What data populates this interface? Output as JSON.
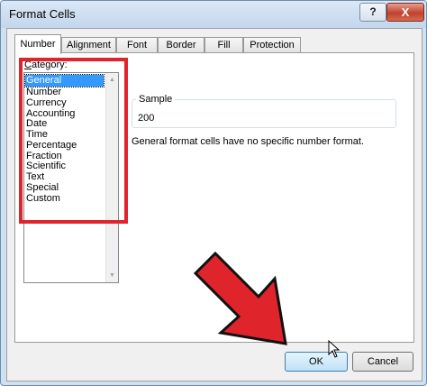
{
  "window": {
    "title": "Format Cells",
    "help_label": "?",
    "close_label": "X"
  },
  "tabs": [
    {
      "label": "Number"
    },
    {
      "label": "Alignment"
    },
    {
      "label": "Font"
    },
    {
      "label": "Border"
    },
    {
      "label": "Fill"
    },
    {
      "label": "Protection"
    }
  ],
  "category": {
    "label_prefix": "C",
    "label_rest": "ategory:",
    "selected": "General",
    "items": [
      "General",
      "Number",
      "Currency",
      "Accounting",
      "Date",
      "Time",
      "Percentage",
      "Fraction",
      "Scientific",
      "Text",
      "Special",
      "Custom"
    ]
  },
  "sample": {
    "title": "Sample",
    "value": "200"
  },
  "description": "General format cells have no specific number format.",
  "buttons": {
    "ok": "OK",
    "cancel": "Cancel"
  },
  "colors": {
    "highlight_red": "#e0242c",
    "selection_blue": "#3399ff"
  }
}
